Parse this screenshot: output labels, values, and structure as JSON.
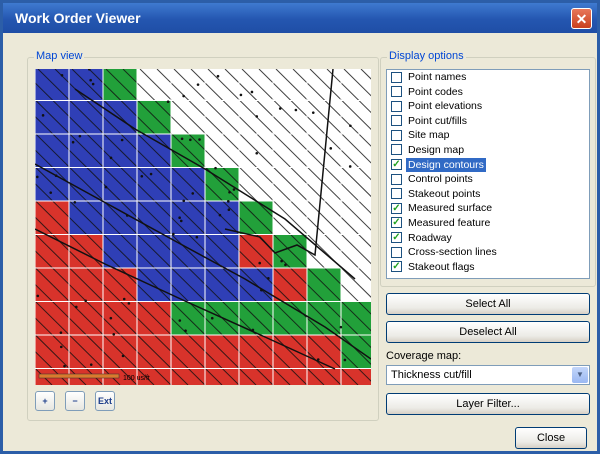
{
  "window": {
    "title": "Work Order Viewer",
    "close_glyph": "✕"
  },
  "map_group": {
    "label": "Map view"
  },
  "map": {
    "scale_label": "100 us/ft"
  },
  "toolbar": {
    "zoom_in": "+",
    "zoom_out": "−",
    "zoom_extents": "Ext"
  },
  "display_group": {
    "label": "Display options"
  },
  "options": [
    {
      "label": "Point names",
      "checked": false,
      "selected": false
    },
    {
      "label": "Point codes",
      "checked": false,
      "selected": false
    },
    {
      "label": "Point elevations",
      "checked": false,
      "selected": false
    },
    {
      "label": "Point cut/fills",
      "checked": false,
      "selected": false
    },
    {
      "label": "Site map",
      "checked": false,
      "selected": false
    },
    {
      "label": "Design map",
      "checked": false,
      "selected": false
    },
    {
      "label": "Design contours",
      "checked": true,
      "selected": true
    },
    {
      "label": "Control points",
      "checked": false,
      "selected": false
    },
    {
      "label": "Stakeout points",
      "checked": false,
      "selected": false
    },
    {
      "label": "Measured surface",
      "checked": true,
      "selected": false
    },
    {
      "label": "Measured feature",
      "checked": true,
      "selected": false
    },
    {
      "label": "Roadway",
      "checked": true,
      "selected": false
    },
    {
      "label": "Cross-section lines",
      "checked": false,
      "selected": false
    },
    {
      "label": "Stakeout flags",
      "checked": true,
      "selected": false
    }
  ],
  "buttons": {
    "select_all": "Select All",
    "deselect_all": "Deselect All",
    "layer_filter": "Layer Filter...",
    "close": "Close"
  },
  "coverage": {
    "label": "Coverage map:",
    "value": "Thickness cut/fill"
  },
  "colors": {
    "cell_blue": "#2f3fb6",
    "cell_red": "#d8332b",
    "cell_green": "#22a03a",
    "title_bar": "#2456b0",
    "selection": "#316ac5"
  }
}
